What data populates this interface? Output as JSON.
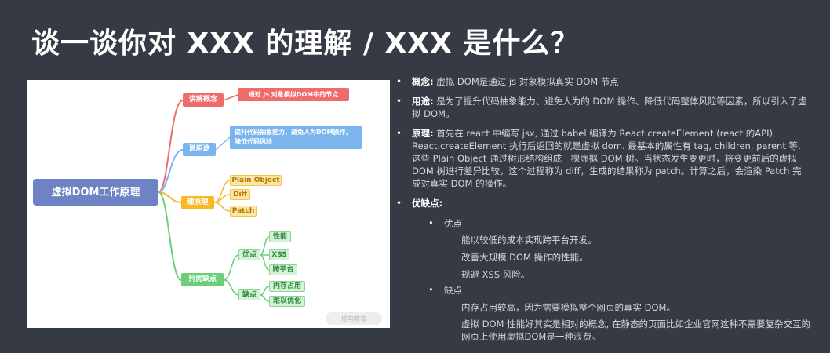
{
  "title": "谈一谈你对 XXX 的理解 / XXX 是什么？",
  "mindmap": {
    "root": "虚拟DOM工作原理",
    "branches": {
      "concept": {
        "label": "讲解概念",
        "leaf": "通过 js 对象模拟DOM中的节点"
      },
      "purpose": {
        "label": "说用途",
        "leaf": "提升代码抽象能力，避免人为DOM操作，降低代码风险"
      },
      "principle": {
        "label": "理原理",
        "leaves": [
          "Plain Object",
          "Diff",
          "Patch"
        ]
      },
      "proscons": {
        "label": "列优缺点",
        "pros": {
          "label": "优点",
          "items": [
            "性能",
            "XSS",
            "跨平台"
          ]
        },
        "cons": {
          "label": "缺点",
          "items": [
            "内存占用",
            "难以优化"
          ]
        }
      }
    },
    "watermark": "拉勾教育"
  },
  "content": {
    "concept": {
      "label": "概念:",
      "text": " 虚拟 DOM是通过 js 对象模拟真实 DOM 节点"
    },
    "purpose": {
      "label": "用途:",
      "text": " 是为了提升代码抽象能力、避免人为的 DOM 操作、降低代码整体风险等因素，所以引入了虚拟 DOM。"
    },
    "principle": {
      "label": "原理:",
      "text": "  首先在 react 中编写 jsx, 通过 babel 编译为 React.createElement (react 的API), React.createElement 执行后返回的就是虚拟 dom. 最基本的属性有 tag, children, parent 等, 这些 Plain Object 通过树形结构组成一棵虚拟 DOM 树。当状态发生变更时，将变更前后的虚拟 DOM 树进行差异比较，这个过程称为 diff，生成的结果称为 patch。计算之后，会渲染 Patch 完成对真实 DOM 的操作。"
    },
    "proscons": {
      "label": "优缺点:",
      "pros_label": "优点",
      "pros": [
        "能以较低的成本实现跨平台开发。",
        "改善大规模 DOM 操作的性能。",
        "规避 XSS 风险。"
      ],
      "cons_label": "缺点",
      "cons": [
        "内存占用较高，因为需要模拟整个网页的真实 DOM。",
        "虚拟 DOM 性能好其实是相对的概念, 在静态的页面比如企业官网这种不需要复杂交互的网页上使用虚拟DOM是一种浪费。"
      ]
    }
  },
  "colors": {
    "background": "#353a45",
    "root": "#6d83c4",
    "red": "#f06b6b",
    "blue": "#7cb5ee",
    "yellow": "#f7b928",
    "green": "#6ccf77"
  }
}
